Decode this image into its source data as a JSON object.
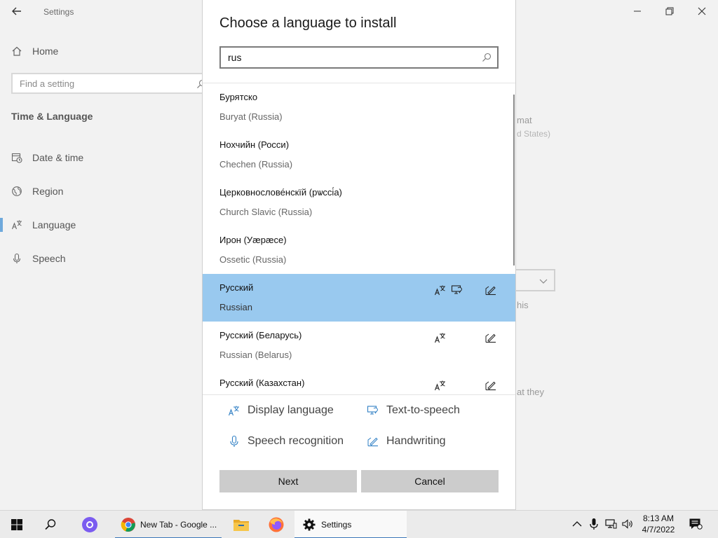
{
  "settings": {
    "app_title": "Settings",
    "home_label": "Home",
    "search_placeholder": "Find a setting",
    "section_title": "Time & Language",
    "nav": [
      {
        "label": "Date & time",
        "icon": "clock-calendar-icon"
      },
      {
        "label": "Region",
        "icon": "globe-icon"
      },
      {
        "label": "Language",
        "icon": "language-icon",
        "active": true
      },
      {
        "label": "Speech",
        "icon": "microphone-icon"
      }
    ],
    "background_fragments": {
      "mat": "mat",
      "d_states": "d States)",
      "his": "his",
      "at_they": "at they"
    }
  },
  "dialog": {
    "title": "Choose a language to install",
    "search_value": "rus",
    "languages": [
      {
        "native": "Бурятско",
        "english": "Buryat (Russia)",
        "features": []
      },
      {
        "native": "Нохчийн (Росси)",
        "english": "Chechen (Russia)",
        "features": []
      },
      {
        "native": "Церковнослове́нскїй (рѡссі́а)",
        "english": "Church Slavic (Russia)",
        "features": []
      },
      {
        "native": "Ирон (Уæрæсе)",
        "english": "Ossetic (Russia)",
        "features": []
      },
      {
        "native": "Русский",
        "english": "Russian",
        "features": [
          "display",
          "tts",
          "handwriting"
        ],
        "selected": true
      },
      {
        "native": "Русский (Беларусь)",
        "english": "Russian (Belarus)",
        "features": [
          "display",
          "handwriting"
        ]
      },
      {
        "native": "Русский (Казахстан)",
        "english": "",
        "features": [
          "display",
          "handwriting"
        ]
      }
    ],
    "legend": {
      "display_language": "Display language",
      "text_to_speech": "Text-to-speech",
      "speech_recognition": "Speech recognition",
      "handwriting": "Handwriting"
    },
    "next_label": "Next",
    "cancel_label": "Cancel"
  },
  "taskbar": {
    "chrome_label": "New Tab - Google ...",
    "settings_label": "Settings",
    "time": "8:13 AM",
    "date": "4/7/2022",
    "accent_color": "#3a76b8"
  }
}
